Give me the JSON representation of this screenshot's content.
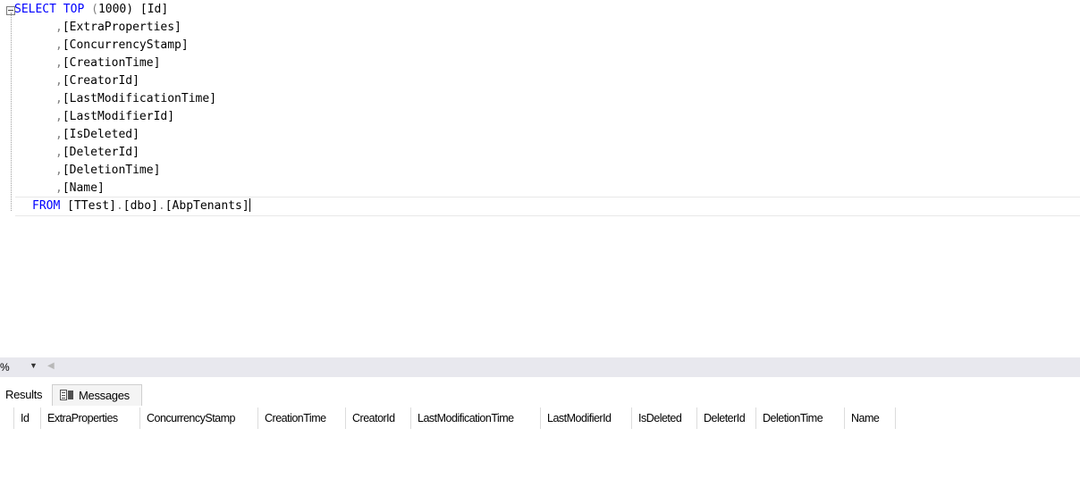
{
  "editor": {
    "lines": [
      {
        "kind": "select",
        "kw1": "SELECT",
        "kw2": "TOP",
        "pre": " (",
        "num": "1000",
        "post": ") [Id]"
      },
      {
        "kind": "col",
        "prefix": ",",
        "text": "[ExtraProperties]"
      },
      {
        "kind": "col",
        "prefix": ",",
        "text": "[ConcurrencyStamp]"
      },
      {
        "kind": "col",
        "prefix": ",",
        "text": "[CreationTime]"
      },
      {
        "kind": "col",
        "prefix": ",",
        "text": "[CreatorId]"
      },
      {
        "kind": "col",
        "prefix": ",",
        "text": "[LastModificationTime]"
      },
      {
        "kind": "col",
        "prefix": ",",
        "text": "[LastModifierId]"
      },
      {
        "kind": "col",
        "prefix": ",",
        "text": "[IsDeleted]"
      },
      {
        "kind": "col",
        "prefix": ",",
        "text": "[DeleterId]"
      },
      {
        "kind": "col",
        "prefix": ",",
        "text": "[DeletionTime]"
      },
      {
        "kind": "col",
        "prefix": ",",
        "text": "[Name]"
      },
      {
        "kind": "from",
        "kw": "FROM",
        "parts": [
          "[TTest]",
          ".",
          "[dbo]",
          ".",
          "[AbpTenants]"
        ]
      }
    ]
  },
  "zoom": {
    "value": "%",
    "dropdown_icon": "chevron-down-icon",
    "scroll_icon": "arrow-left-icon"
  },
  "tabs": {
    "results_label": "Results",
    "messages_label": "Messages",
    "messages_icon": "messages-icon"
  },
  "grid": {
    "columns": [
      "Id",
      "ExtraProperties",
      "ConcurrencyStamp",
      "CreationTime",
      "CreatorId",
      "LastModificationTime",
      "LastModifierId",
      "IsDeleted",
      "DeleterId",
      "DeletionTime",
      "Name"
    ],
    "rows": []
  },
  "colors": {
    "keyword": "#0000ff",
    "punctuation": "#808080",
    "zoom_strip": "#e8e8ee"
  }
}
